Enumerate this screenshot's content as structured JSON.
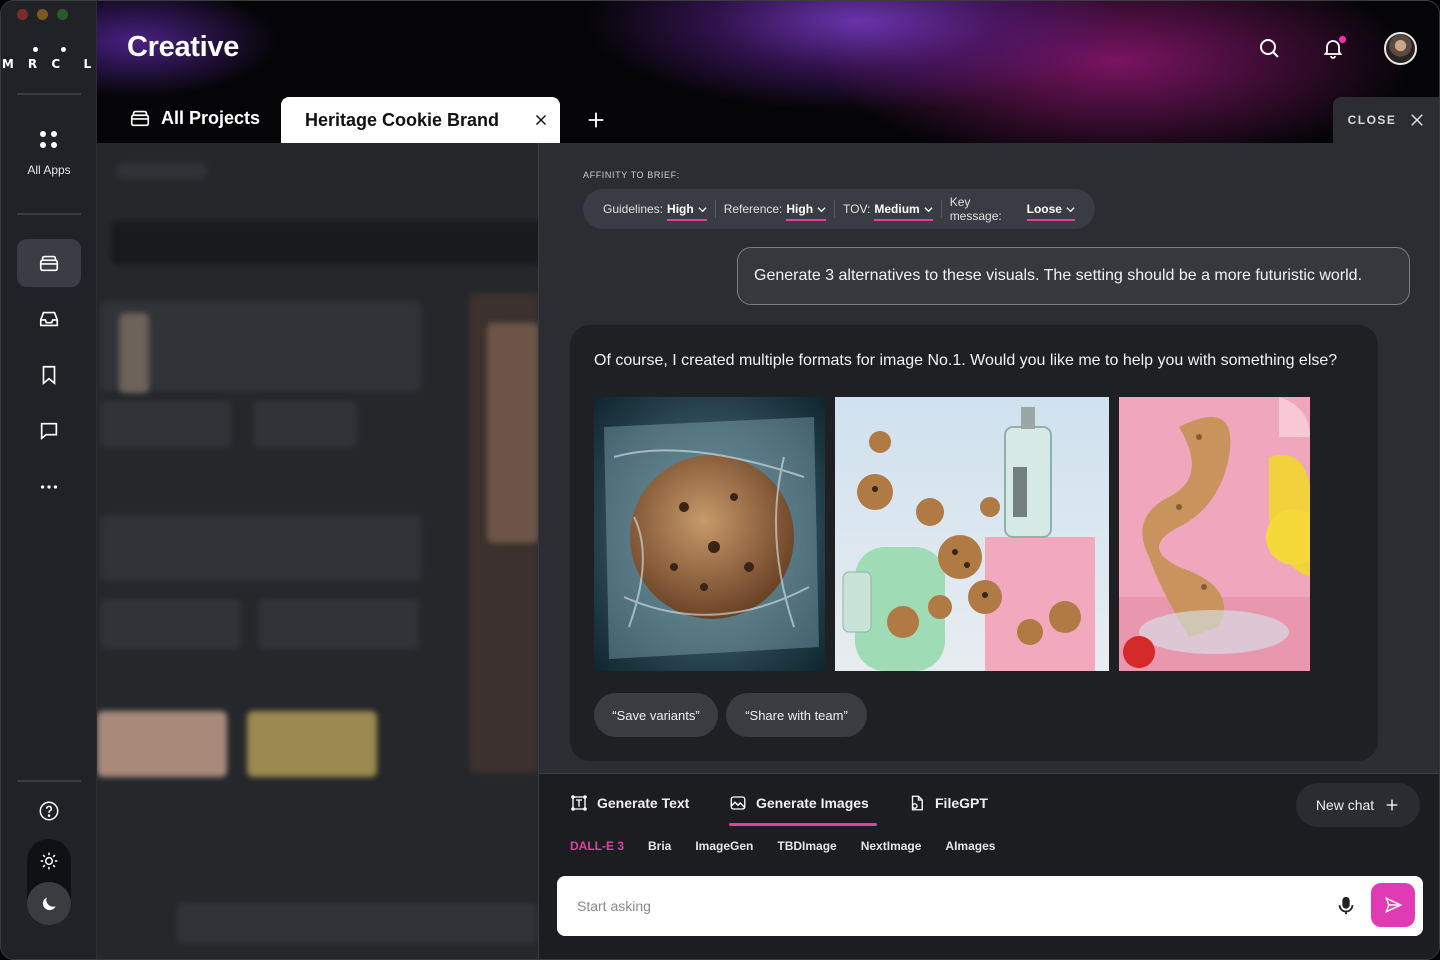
{
  "app": {
    "brand_logo": "MRCL",
    "title": "Creative"
  },
  "sidebar": {
    "all_apps_label": "All Apps",
    "items": [
      {
        "icon": "projects-icon",
        "active": true
      },
      {
        "icon": "inbox-icon",
        "active": false
      },
      {
        "icon": "bookmark-icon",
        "active": false
      },
      {
        "icon": "chat-icon",
        "active": false
      },
      {
        "icon": "more-icon",
        "active": false
      }
    ],
    "help_icon": "help-icon",
    "theme": {
      "light_icon": "sun-icon",
      "dark_icon": "moon-icon",
      "selected": "dark"
    }
  },
  "header": {
    "tabs": {
      "all_projects": "All Projects",
      "active_tab": "Heritage Cookie Brand"
    },
    "close_label": "CLOSE",
    "notification_dot_color": "#ff2bb0"
  },
  "chat": {
    "affinity_label": "AFFINITY TO BRIEF:",
    "affinity": [
      {
        "key": "Guidelines:",
        "value": "High"
      },
      {
        "key": "Reference:",
        "value": "High"
      },
      {
        "key": "TOV:",
        "value": "Medium"
      },
      {
        "key": "Key message:",
        "value": "Loose"
      }
    ],
    "user_message": "Generate 3 alternatives to these visuals. The setting should be a more futuristic world.",
    "ai_message": "Of course, I created multiple formats for image No.1. Would you like me to help you with something else?",
    "images": [
      "cookie in plastic wrap",
      "floating cookies with bottles",
      "twisted cookie with fruit"
    ],
    "chips": [
      "“Save variants”",
      "“Share with team”"
    ]
  },
  "composer": {
    "modes": [
      {
        "label": "Generate Text",
        "icon": "text-gen-icon",
        "active": false
      },
      {
        "label": "Generate Images",
        "icon": "image-gen-icon",
        "active": true
      },
      {
        "label": "FileGPT",
        "icon": "file-gpt-icon",
        "active": false
      }
    ],
    "new_chat_label": "New chat",
    "models": [
      "DALL-E 3",
      "Bria",
      "ImageGen",
      "TBDImage",
      "NextImage",
      "AImages"
    ],
    "selected_model": "DALL-E 3",
    "placeholder": "Start asking",
    "accent_color": "#e040a0"
  }
}
